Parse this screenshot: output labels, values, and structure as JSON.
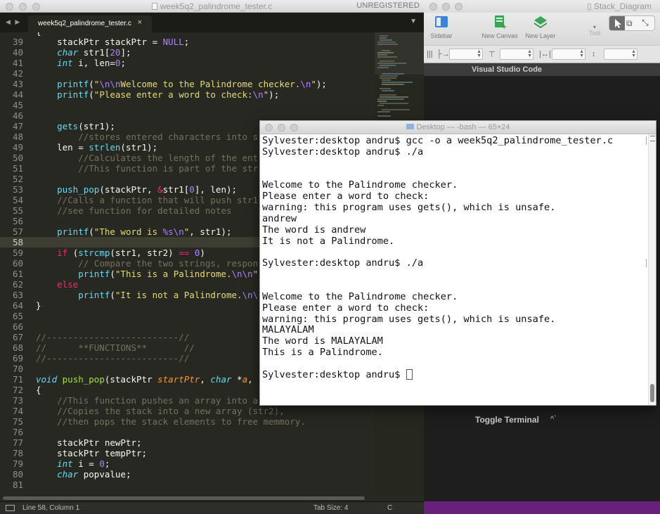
{
  "editor": {
    "window_title": "week5q2_palindrome_tester.c",
    "license_status": "UNREGISTERED",
    "tab_label": "week5q2_palindrome_tester.c",
    "tab_close": "×",
    "tab_nav": "◀ ▶",
    "tab_menu": "▼",
    "status": {
      "position": "Line 58, Column 1",
      "tab_size": "Tab Size: 4",
      "syntax": "C"
    },
    "current_line": 58,
    "code_lines": [
      {
        "n": "39",
        "html": "    stackPtr stackPtr = <span class=\"e\">NULL</span>;"
      },
      {
        "n": "40",
        "html": "    <span class=\"t\">char</span> str1[<span class=\"n\">20</span>];"
      },
      {
        "n": "41",
        "html": "    <span class=\"t\">int</span> i, len=<span class=\"n\">0</span>;"
      },
      {
        "n": "42",
        "html": ""
      },
      {
        "n": "43",
        "html": "    <span class=\"f\">printf</span>(<span class=\"s\">\"</span><span class=\"e\">\\n\\n</span><span class=\"s\">Welcome to the Palindrome checker.</span><span class=\"e\">\\n</span><span class=\"s\">\"</span>);"
      },
      {
        "n": "44",
        "html": "    <span class=\"f\">printf</span>(<span class=\"s\">\"Please enter a word to check:</span><span class=\"e\">\\n</span><span class=\"s\">\"</span>);"
      },
      {
        "n": "45",
        "html": ""
      },
      {
        "n": "46",
        "html": ""
      },
      {
        "n": "47",
        "html": "    <span class=\"f\">gets</span>(str1);"
      },
      {
        "n": "48",
        "html": "        <span class=\"c\">//stores entered characters into s</span>"
      },
      {
        "n": "49",
        "html": "    len = <span class=\"f\">strlen</span>(str1);"
      },
      {
        "n": "50",
        "html": "        <span class=\"c\">//Calculates the length of the ent</span>"
      },
      {
        "n": "51",
        "html": "        <span class=\"c\">//This function is part of the str</span>"
      },
      {
        "n": "52",
        "html": ""
      },
      {
        "n": "53",
        "html": "    <span class=\"f\">push_pop</span>(stackPtr, <span class=\"k\">&amp;</span>str1[<span class=\"n\">0</span>], len);"
      },
      {
        "n": "54",
        "html": "    <span class=\"c\">//Calls a function that will push str1</span>"
      },
      {
        "n": "55",
        "html": "    <span class=\"c\">//see function for detailed notes</span>"
      },
      {
        "n": "56",
        "html": ""
      },
      {
        "n": "57",
        "html": "    <span class=\"f\">printf</span>(<span class=\"s\">\"The word is </span><span class=\"e\">%s\\n</span><span class=\"s\">\"</span>, str1);"
      },
      {
        "n": "58",
        "html": ""
      },
      {
        "n": "59",
        "html": "    <span class=\"k\">if</span> (<span class=\"f\">strcmp</span>(str1, str2) <span class=\"k\">==</span> <span class=\"n\">0</span>)"
      },
      {
        "n": "60",
        "html": "        <span class=\"c\">// Compare the two strings, respon</span>"
      },
      {
        "n": "61",
        "html": "        <span class=\"f\">printf</span>(<span class=\"s\">\"This is a Palindrome.</span><span class=\"e\">\\n\\n</span><span class=\"s\">\"</span>"
      },
      {
        "n": "62",
        "html": "    <span class=\"k\">else</span>"
      },
      {
        "n": "63",
        "html": "        <span class=\"f\">printf</span>(<span class=\"s\">\"It is not a Palindrome.</span><span class=\"e\">\\n\\</span>"
      },
      {
        "n": "64",
        "html": "}"
      },
      {
        "n": "65",
        "html": ""
      },
      {
        "n": "66",
        "html": ""
      },
      {
        "n": "67",
        "html": "<span class=\"c\">//-------------------------//</span>"
      },
      {
        "n": "68",
        "html": "<span class=\"c\">//      **FUNCTIONS**       //</span>"
      },
      {
        "n": "69",
        "html": "<span class=\"c\">//-------------------------//</span>"
      },
      {
        "n": "70",
        "html": ""
      },
      {
        "n": "71",
        "html": "<span class=\"t\">void</span> <span class=\"g\">push_pop</span>(stackPtr <span class=\"p\">startPtr</span>, <span class=\"t\">char</span> *<span class=\"p\">a</span>,"
      },
      {
        "n": "72",
        "html": "{"
      },
      {
        "n": "73",
        "html": "    <span class=\"c\">//This function pushes an array into a</span>"
      },
      {
        "n": "74",
        "html": "    <span class=\"c\">//Copies the stack into a new array (str2),</span>"
      },
      {
        "n": "75",
        "html": "    <span class=\"c\">//then pops the stack elements to free memmory.</span>"
      },
      {
        "n": "76",
        "html": ""
      },
      {
        "n": "77",
        "html": "    stackPtr newPtr;"
      },
      {
        "n": "78",
        "html": "    stackPtr tempPtr;"
      },
      {
        "n": "79",
        "html": "    <span class=\"t\">int</span> i = <span class=\"n\">0</span>;"
      },
      {
        "n": "80",
        "html": "    <span class=\"t\">char</span> popvalue;"
      },
      {
        "n": "81",
        "html": ""
      }
    ]
  },
  "stack_diagram": {
    "window_title": "Stack_Diagram",
    "toolbar": {
      "sidebar": "Sidebar",
      "new_canvas": "New Canvas",
      "new_layer": "New Layer",
      "tool": "Tool"
    }
  },
  "vscode": {
    "title": "Visual Studio Code",
    "toggle_terminal": "Toggle Terminal",
    "toggle_shortcut": "^`"
  },
  "terminal": {
    "title": "Desktop — -bash — 65×24",
    "lines": [
      "Sylvester:desktop andru$ gcc -o a week5q2_palindrome_tester.c",
      "Sylvester:desktop andru$ ./a",
      "",
      "",
      "Welcome to the Palindrome checker.",
      "Please enter a word to check:",
      "warning: this program uses gets(), which is unsafe.",
      "andrew",
      "The word is andrew",
      "It is not a Palindrome.",
      "",
      "Sylvester:desktop andru$ ./a",
      "",
      "",
      "Welcome to the Palindrome checker.",
      "Please enter a word to check:",
      "warning: this program uses gets(), which is unsafe.",
      "MALAYALAM",
      "The word is MALAYALAM",
      "This is a Palindrome.",
      "",
      "Sylvester:desktop andru$ "
    ]
  }
}
